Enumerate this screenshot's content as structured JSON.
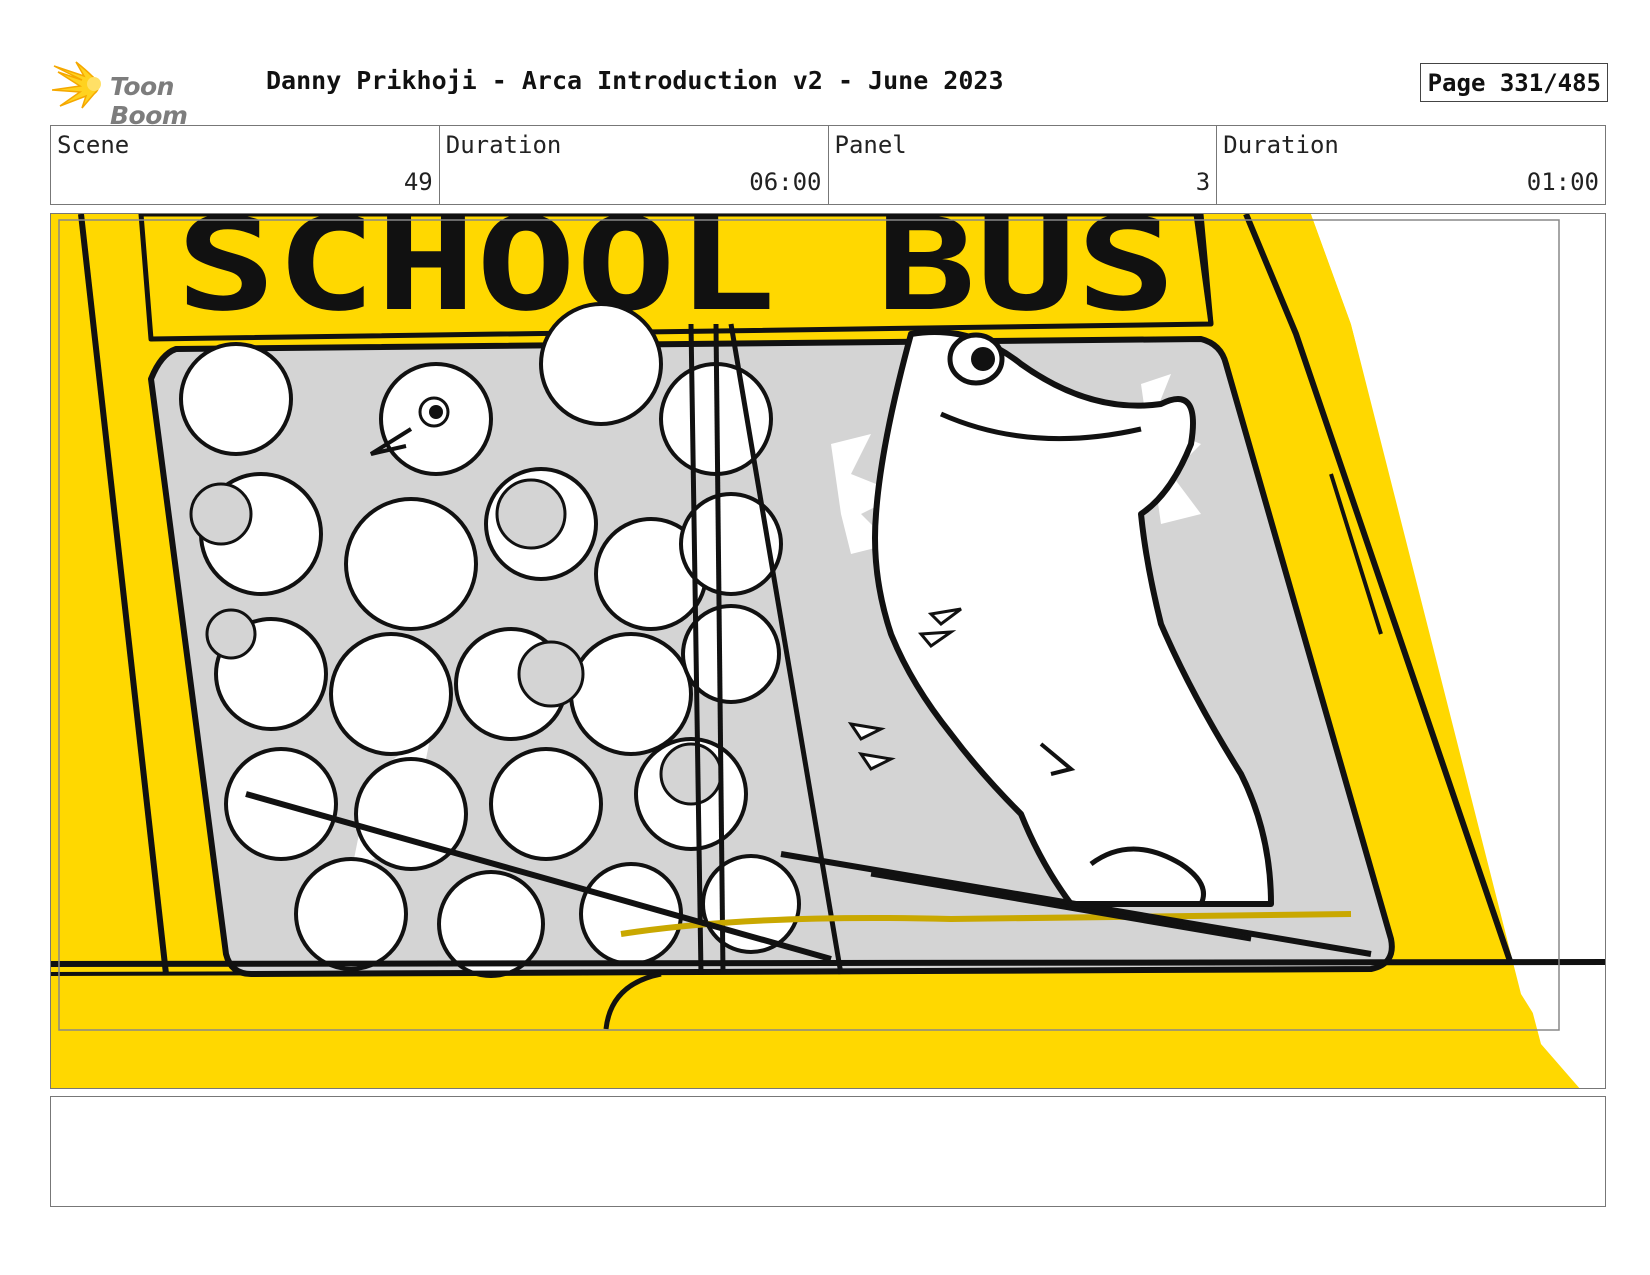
{
  "header": {
    "logo_text": "Toon Boom",
    "title": "Danny Prikhoji - Arca Introduction v2 - June 2023",
    "page": "Page 331/485"
  },
  "info": {
    "scene_label": "Scene",
    "scene_value": "49",
    "scene_duration_label": "Duration",
    "scene_duration_value": "06:00",
    "panel_label": "Panel",
    "panel_value": "3",
    "panel_duration_label": "Duration",
    "panel_duration_value": "01:00"
  },
  "sketch": {
    "sign_text": "SCHOOL BUS",
    "colors": {
      "bus_yellow": "#FFD800",
      "window_gray": "#D4D4D4",
      "ink": "#111111"
    }
  },
  "notes": {
    "text": ""
  }
}
